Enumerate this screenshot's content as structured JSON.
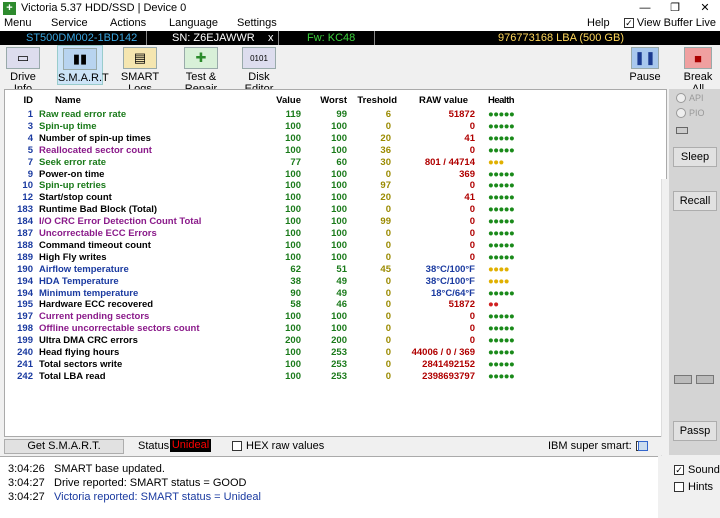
{
  "titlebar": {
    "title": "Victoria 5.37 HDD/SSD | Device 0",
    "min": "—",
    "max": "❐",
    "close": "✕",
    "icon": "+"
  },
  "menu": {
    "items": [
      "Menu",
      "Service",
      "Actions",
      "Language",
      "Settings",
      "Help"
    ],
    "view_buffer": "View Buffer Live"
  },
  "info": {
    "model": "ST500DM002-1BD142",
    "sn": "SN: Z6EJAWWR",
    "x": "x",
    "fw": "Fw: KC48",
    "lba": "976773168 LBA (500 GB)"
  },
  "toolbar": {
    "drive_info": "Drive Info",
    "smart": "S.M.A.R.T",
    "smart_logs": "SMART Logs",
    "test_repair": "Test & Repair",
    "disk_editor": "Disk Editor",
    "pause": "Pause",
    "break_all": "Break All"
  },
  "table": {
    "headers": {
      "id": "ID",
      "name": "Name",
      "value": "Value",
      "worst": "Worst",
      "threshold": "Treshold",
      "raw": "RAW value",
      "health": "Health"
    },
    "rows": [
      {
        "id": "1",
        "name": "Raw read error rate",
        "value": "119",
        "worst": "99",
        "thr": "6",
        "raw": "51872",
        "health": "●●●●●",
        "nc": "#1a7a1a",
        "rc": "#b00000",
        "hc": "#1a8a1a"
      },
      {
        "id": "3",
        "name": "Spin-up time",
        "value": "100",
        "worst": "100",
        "thr": "0",
        "raw": "0",
        "health": "●●●●●",
        "nc": "#1a7a1a",
        "rc": "#b00000",
        "hc": "#1a8a1a"
      },
      {
        "id": "4",
        "name": "Number of spin-up times",
        "value": "100",
        "worst": "100",
        "thr": "20",
        "raw": "41",
        "health": "●●●●●",
        "nc": "#000000",
        "rc": "#b00000",
        "hc": "#1a8a1a"
      },
      {
        "id": "5",
        "name": "Reallocated sector count",
        "value": "100",
        "worst": "100",
        "thr": "36",
        "raw": "0",
        "health": "●●●●●",
        "nc": "#8a1a8a",
        "rc": "#b00000",
        "hc": "#1a8a1a"
      },
      {
        "id": "7",
        "name": "Seek error rate",
        "value": "77",
        "worst": "60",
        "thr": "30",
        "raw": "801 / 44714",
        "health": "●●●",
        "nc": "#1a7a1a",
        "rc": "#b00000",
        "hc": "#e0b000"
      },
      {
        "id": "9",
        "name": "Power-on time",
        "value": "100",
        "worst": "100",
        "thr": "0",
        "raw": "369",
        "health": "●●●●●",
        "nc": "#000000",
        "rc": "#b00000",
        "hc": "#1a8a1a"
      },
      {
        "id": "10",
        "name": "Spin-up retries",
        "value": "100",
        "worst": "100",
        "thr": "97",
        "raw": "0",
        "health": "●●●●●",
        "nc": "#1a7a1a",
        "rc": "#b00000",
        "hc": "#1a8a1a"
      },
      {
        "id": "12",
        "name": "Start/stop count",
        "value": "100",
        "worst": "100",
        "thr": "20",
        "raw": "41",
        "health": "●●●●●",
        "nc": "#000000",
        "rc": "#b00000",
        "hc": "#1a8a1a"
      },
      {
        "id": "183",
        "name": "Runtime Bad Block (Total)",
        "value": "100",
        "worst": "100",
        "thr": "0",
        "raw": "0",
        "health": "●●●●●",
        "nc": "#000000",
        "rc": "#b00000",
        "hc": "#1a8a1a"
      },
      {
        "id": "184",
        "name": "I/O CRC Error Detection Count Total",
        "value": "100",
        "worst": "100",
        "thr": "99",
        "raw": "0",
        "health": "●●●●●",
        "nc": "#8a1a8a",
        "rc": "#b00000",
        "hc": "#1a8a1a"
      },
      {
        "id": "187",
        "name": "Uncorrectable ECC Errors",
        "value": "100",
        "worst": "100",
        "thr": "0",
        "raw": "0",
        "health": "●●●●●",
        "nc": "#8a1a8a",
        "rc": "#b00000",
        "hc": "#1a8a1a"
      },
      {
        "id": "188",
        "name": "Command timeout count",
        "value": "100",
        "worst": "100",
        "thr": "0",
        "raw": "0",
        "health": "●●●●●",
        "nc": "#000000",
        "rc": "#b00000",
        "hc": "#1a8a1a"
      },
      {
        "id": "189",
        "name": "High Fly writes",
        "value": "100",
        "worst": "100",
        "thr": "0",
        "raw": "0",
        "health": "●●●●●",
        "nc": "#000000",
        "rc": "#b00000",
        "hc": "#1a8a1a"
      },
      {
        "id": "190",
        "name": "Airflow temperature",
        "value": "62",
        "worst": "51",
        "thr": "45",
        "raw": "38°C/100°F",
        "health": "●●●●",
        "nc": "#1a3aa0",
        "rc": "#1a3aa0",
        "hc": "#e0b000"
      },
      {
        "id": "194",
        "name": "HDA Temperature",
        "value": "38",
        "worst": "49",
        "thr": "0",
        "raw": "38°C/100°F",
        "health": "●●●●",
        "nc": "#1a3aa0",
        "rc": "#1a3aa0",
        "hc": "#e0b000"
      },
      {
        "id": "194",
        "name": "Minimum temperature",
        "value": "90",
        "worst": "49",
        "thr": "0",
        "raw": "18°C/64°F",
        "health": "●●●●●",
        "nc": "#1a3aa0",
        "rc": "#1a3aa0",
        "hc": "#1a8a1a"
      },
      {
        "id": "195",
        "name": "Hardware ECC recovered",
        "value": "58",
        "worst": "46",
        "thr": "0",
        "raw": "51872",
        "health": "●●",
        "nc": "#000000",
        "rc": "#b00000",
        "hc": "#d02020"
      },
      {
        "id": "197",
        "name": "Current pending sectors",
        "value": "100",
        "worst": "100",
        "thr": "0",
        "raw": "0",
        "health": "●●●●●",
        "nc": "#8a1a8a",
        "rc": "#b00000",
        "hc": "#1a8a1a"
      },
      {
        "id": "198",
        "name": "Offline uncorrectable sectors count",
        "value": "100",
        "worst": "100",
        "thr": "0",
        "raw": "0",
        "health": "●●●●●",
        "nc": "#8a1a8a",
        "rc": "#b00000",
        "hc": "#1a8a1a"
      },
      {
        "id": "199",
        "name": "Ultra DMA CRC errors",
        "value": "200",
        "worst": "200",
        "thr": "0",
        "raw": "0",
        "health": "●●●●●",
        "nc": "#000000",
        "rc": "#b00000",
        "hc": "#1a8a1a"
      },
      {
        "id": "240",
        "name": "Head flying hours",
        "value": "100",
        "worst": "253",
        "thr": "0",
        "raw": "44006 / 0 / 369",
        "health": "●●●●●",
        "nc": "#000000",
        "rc": "#b00000",
        "hc": "#1a8a1a"
      },
      {
        "id": "241",
        "name": "Total sectors write",
        "value": "100",
        "worst": "253",
        "thr": "0",
        "raw": "2841492152",
        "health": "●●●●●",
        "nc": "#000000",
        "rc": "#b00000",
        "hc": "#1a8a1a"
      },
      {
        "id": "242",
        "name": "Total LBA read",
        "value": "100",
        "worst": "253",
        "thr": "0",
        "raw": "2398693797",
        "health": "●●●●●",
        "nc": "#000000",
        "rc": "#b00000",
        "hc": "#1a8a1a"
      }
    ]
  },
  "right": {
    "api": "API",
    "pio": "PIO",
    "sleep": "Sleep",
    "recall": "Recall",
    "passp": "Passp"
  },
  "status": {
    "get_smart": "Get S.M.A.R.T.",
    "label": "Status:",
    "value": "Unideal",
    "hex": "HEX raw values",
    "ibm": "IBM super smart:"
  },
  "log": [
    {
      "time": "3:04:26",
      "text": "SMART base updated.",
      "color": "#000000"
    },
    {
      "time": "3:04:27",
      "text": "Drive reported: SMART status = GOOD",
      "color": "#000000"
    },
    {
      "time": "3:04:27",
      "text": "Victoria reported: SMART status = Unideal",
      "color": "#1a3aa0"
    }
  ],
  "bottom_right": {
    "sound": "Sound",
    "hints": "Hints"
  },
  "colors": {
    "green": "#1a7a1a",
    "red": "#b00000",
    "blue": "#1a3aa0",
    "purple": "#8a1a8a"
  }
}
